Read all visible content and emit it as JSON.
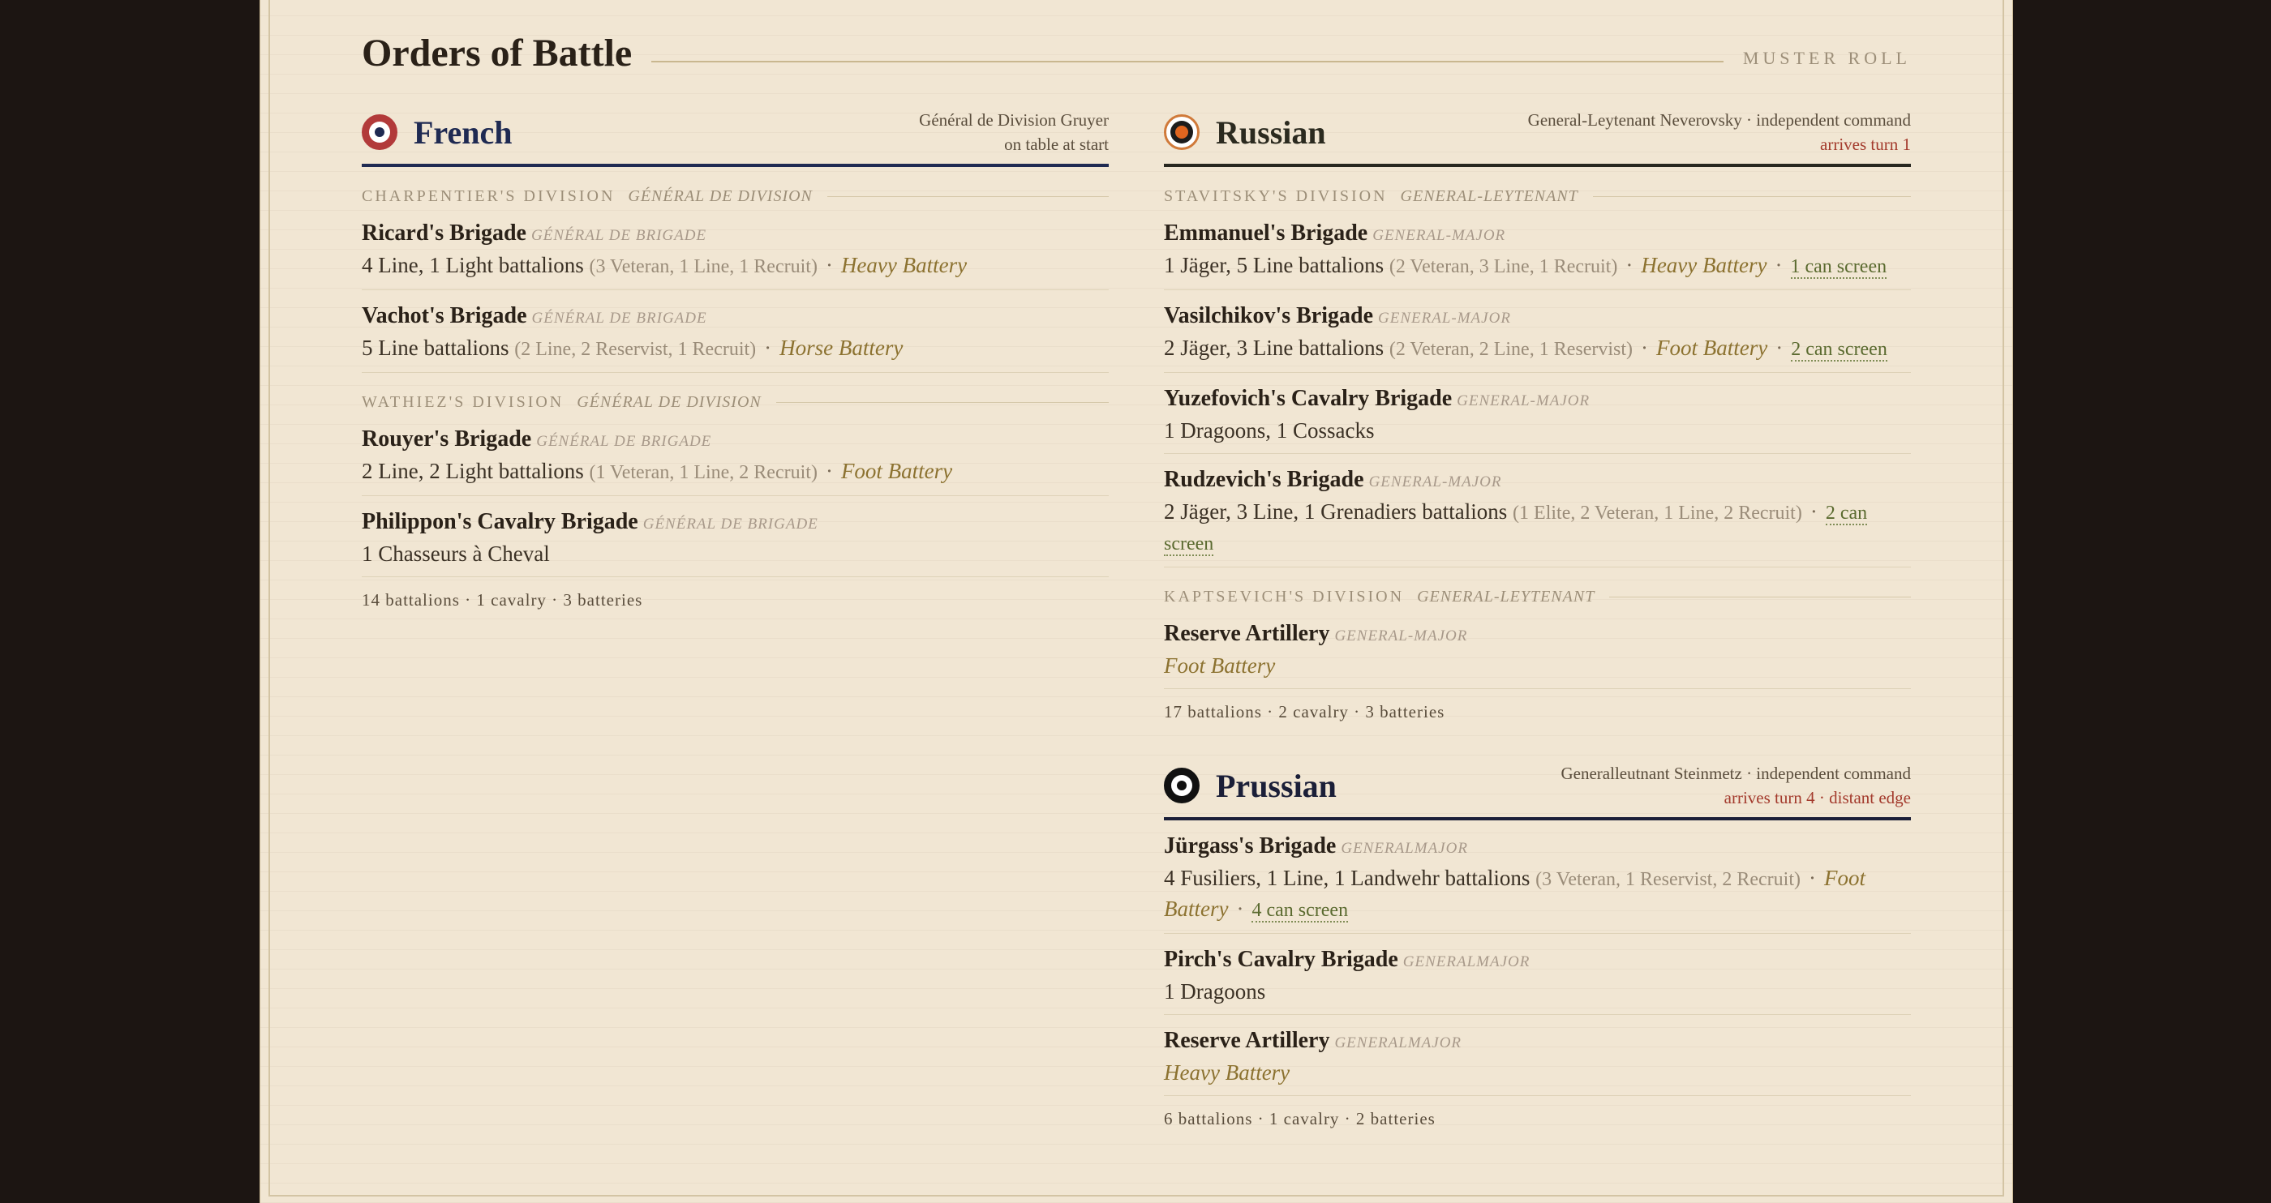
{
  "header": {
    "title": "Orders of Battle",
    "tag": "MUSTER ROLL"
  },
  "armies": {
    "french": {
      "name": "French",
      "commander": "Général de Division Gruyer",
      "status": "on table at start",
      "divisions": [
        {
          "name": "CHARPENTIER'S DIVISION",
          "rank": "GÉNÉRAL DE DIVISION",
          "brigades": [
            {
              "name": "Ricard's Brigade",
              "rank": "GÉNÉRAL DE BRIGADE",
              "units": "4 Line, 1 Light battalions",
              "quality": "(3 Veteran, 1 Line, 1 Recruit)",
              "battery": "Heavy Battery"
            },
            {
              "name": "Vachot's Brigade",
              "rank": "GÉNÉRAL DE BRIGADE",
              "units": "5 Line battalions",
              "quality": "(2 Line, 2 Reservist, 1 Recruit)",
              "battery": "Horse Battery"
            }
          ]
        },
        {
          "name": "WATHIEZ'S DIVISION",
          "rank": "GÉNÉRAL DE DIVISION",
          "brigades": [
            {
              "name": "Rouyer's Brigade",
              "rank": "GÉNÉRAL DE BRIGADE",
              "units": "2 Line, 2 Light battalions",
              "quality": "(1 Veteran, 1 Line, 2 Recruit)",
              "battery": "Foot Battery"
            },
            {
              "name": "Philippon's Cavalry Brigade",
              "rank": "GÉNÉRAL DE BRIGADE",
              "units": "1 Chasseurs à Cheval"
            }
          ]
        }
      ],
      "totals": "14 battalions · 1 cavalry · 3 batteries"
    },
    "russian": {
      "name": "Russian",
      "commander": "General-Leytenant Neverovsky · independent command",
      "status": "arrives turn 1",
      "divisions": [
        {
          "name": "STAVITSKY'S DIVISION",
          "rank": "GENERAL-LEYTENANT",
          "brigades": [
            {
              "name": "Emmanuel's Brigade",
              "rank": "GENERAL-MAJOR",
              "units": "1 Jäger, 5 Line battalions",
              "quality": "(2 Veteran, 3 Line, 1 Recruit)",
              "battery": "Heavy Battery",
              "screen": "1 can screen"
            },
            {
              "name": "Vasilchikov's Brigade",
              "rank": "GENERAL-MAJOR",
              "units": "2 Jäger, 3 Line battalions",
              "quality": "(2 Veteran, 2 Line, 1 Reservist)",
              "battery": "Foot Battery",
              "screen": "2 can screen"
            },
            {
              "name": "Yuzefovich's Cavalry Brigade",
              "rank": "GENERAL-MAJOR",
              "units": "1 Dragoons, 1 Cossacks"
            },
            {
              "name": "Rudzevich's Brigade",
              "rank": "GENERAL-MAJOR",
              "units": "2 Jäger, 3 Line, 1 Grenadiers battalions",
              "quality": "(1 Elite, 2 Veteran, 1 Line, 2 Recruit)",
              "screen": "2 can screen"
            }
          ]
        },
        {
          "name": "KAPTSEVICH'S DIVISION",
          "rank": "GENERAL-LEYTENANT",
          "brigades": [
            {
              "name": "Reserve Artillery",
              "rank": "GENERAL-MAJOR",
              "battery": "Foot Battery"
            }
          ]
        }
      ],
      "totals": "17 battalions · 2 cavalry · 3 batteries"
    },
    "prussian": {
      "name": "Prussian",
      "commander": "Generalleutnant Steinmetz · independent command",
      "status": "arrives turn 4 · distant edge",
      "brigades": [
        {
          "name": "Jürgass's Brigade",
          "rank": "GENERALMAJOR",
          "units": "4 Fusiliers, 1 Line, 1 Landwehr battalions",
          "quality": "(3 Veteran, 1 Reservist, 2 Recruit)",
          "battery": "Foot Battery",
          "screen": "4 can screen"
        },
        {
          "name": "Pirch's Cavalry Brigade",
          "rank": "GENERALMAJOR",
          "units": "1 Dragoons"
        },
        {
          "name": "Reserve Artillery",
          "rank": "GENERALMAJOR",
          "battery": "Heavy Battery"
        }
      ],
      "totals": "6 battalions · 1 cavalry · 2 batteries"
    }
  },
  "separator": "·",
  "colors": {
    "french": "#1f2a52",
    "russian": "#28271f",
    "prussian": "#1b1f38",
    "battery": "#8c7230",
    "arrival": "#a33a2c"
  }
}
